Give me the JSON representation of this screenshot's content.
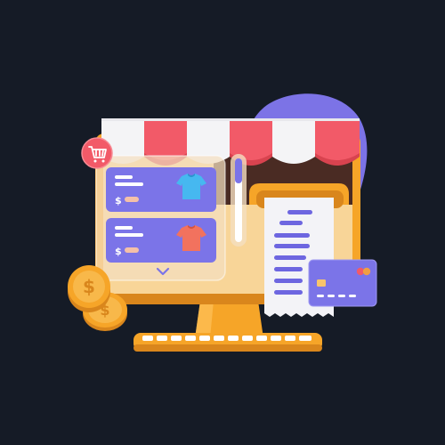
{
  "scene": {
    "description_free": true,
    "colors": {
      "background": "#151b26",
      "blob": "#7c73e6",
      "awning_red": "#f25a68",
      "awning_white": "#f4f4f6",
      "monitor_frame": "#f6a528",
      "monitor_frame_dark": "#d9861c",
      "monitor_inner": "#f7d8a6",
      "shop_interior": "#4a2b23",
      "product_card": "#7b74e8",
      "product_card_text": "#ffffff",
      "price_pill": "#f4c0a8",
      "shirt_blue": "#46b8f0",
      "shirt_red": "#f2725e",
      "receipt": "#f3f3f7",
      "receipt_lines": "#6d66e0",
      "credit_card": "#7b74e8",
      "chip": "#f8c46b",
      "mastercard_red": "#f25a68",
      "mastercard_orange": "#f8a13a",
      "coin": "#f6a528",
      "keyboard": "#f6a528",
      "keys": "#ffffff",
      "cart_badge": "#f25a68"
    },
    "product_cards": [
      {
        "currency_symbol": "$",
        "shirt_color": "blue"
      },
      {
        "currency_symbol": "$",
        "shirt_color": "red"
      }
    ],
    "coins": [
      {
        "symbol": "$"
      },
      {
        "symbol": "$"
      }
    ],
    "icons": {
      "cart": "shopping-cart-icon",
      "chevron": "chevron-down-icon",
      "card_chip": "chip-icon",
      "card_brand": "card-brand-circles-icon"
    }
  }
}
